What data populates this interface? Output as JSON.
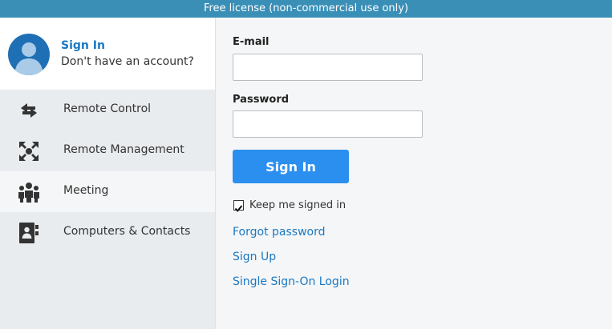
{
  "banner": {
    "text": "Free license (non-commercial use only)"
  },
  "account": {
    "title": "Sign In",
    "subtitle": "Don't have an account?"
  },
  "nav": {
    "items": [
      {
        "label": "Remote Control",
        "icon": "arrows-exchange-icon",
        "active": false
      },
      {
        "label": "Remote Management",
        "icon": "arrows-expand-icon",
        "active": false
      },
      {
        "label": "Meeting",
        "icon": "group-icon",
        "active": true
      },
      {
        "label": "Computers & Contacts",
        "icon": "contact-book-icon",
        "active": false
      }
    ]
  },
  "form": {
    "email_label": "E-mail",
    "email_value": "",
    "password_label": "Password",
    "password_value": "",
    "signin_label": "Sign In",
    "keep_signed_in_label": "Keep me signed in",
    "keep_signed_in_checked": true,
    "forgot_label": "Forgot password",
    "signup_label": "Sign Up",
    "sso_label": "Single Sign-On Login"
  },
  "colors": {
    "banner": "#3a8fb7",
    "accent": "#1b78c2",
    "button": "#2b8ff0",
    "sidebar": "#e9ecef",
    "avatar": "#1f6fb5"
  }
}
